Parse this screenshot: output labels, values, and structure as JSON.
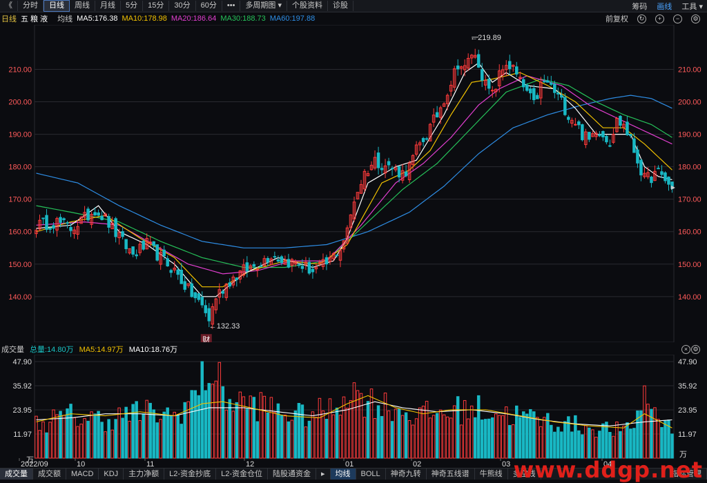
{
  "toolbar": {
    "back": "《",
    "tabs": [
      "分时",
      "日线",
      "周线",
      "月线",
      "5分",
      "15分",
      "30分",
      "60分",
      "•••",
      "多周期图 ▾",
      "个股资料",
      "诊股"
    ],
    "active": 1,
    "right": [
      "筹码",
      "画线",
      "工具 ▾"
    ]
  },
  "info": {
    "period": "日线",
    "name": "五 粮 液",
    "ma_label": "均线",
    "ma5": "MA5:176.38",
    "ma10": "MA10:178.98",
    "ma20": "MA20:186.64",
    "ma30": "MA30:188.73",
    "ma60": "MA60:197.88",
    "fq": "前复权"
  },
  "vol_info": {
    "title": "成交量",
    "total": "总量:14.80万",
    "ma5": "MA5:14.97万",
    "ma10": "MA10:18.76万"
  },
  "bottom_tabs": [
    "成交量",
    "成交额",
    "MACD",
    "KDJ",
    "主力净额",
    "L2-资金抄底",
    "L2-资金仓位",
    "陆股通资金",
    "▸",
    "均线",
    "BOLL",
    "神奇九转",
    "神奇五线谱",
    "牛熊线",
    "多空线",
    "指标管理"
  ],
  "watermark": "www.ddgp.net",
  "colors": {
    "up": "#ff3b3b",
    "down": "#19b8c4",
    "ma5": "#ffffff",
    "ma10": "#f2c200",
    "ma20": "#e23fd0",
    "ma30": "#26c25a",
    "ma60": "#2e8ee6",
    "grid": "#2a2a30",
    "axis": "#ff5a5a"
  },
  "chart_data": [
    {
      "type": "candlestick",
      "title": "五粮液 日线",
      "y_ticks": [
        140,
        150,
        160,
        170,
        180,
        190,
        200,
        210
      ],
      "ylim": [
        127,
        222
      ],
      "x_ticks": [
        "2022/09",
        "10",
        "11",
        "12",
        "01",
        "02",
        "03",
        "04"
      ],
      "annotations": [
        {
          "text": "219.89",
          "label": "high"
        },
        {
          "text": "132.33",
          "label": "low"
        },
        {
          "text": "财",
          "label": "report marker"
        }
      ],
      "ohlc_count": 150,
      "series_keypoints": {
        "close": [
          [
            0,
            162
          ],
          [
            6,
            163
          ],
          [
            10,
            161
          ],
          [
            14,
            164
          ],
          [
            17,
            167
          ],
          [
            20,
            164
          ],
          [
            24,
            158
          ],
          [
            28,
            153
          ],
          [
            32,
            156
          ],
          [
            36,
            152
          ],
          [
            40,
            148
          ],
          [
            44,
            142
          ],
          [
            48,
            137
          ],
          [
            50,
            133
          ],
          [
            52,
            140
          ],
          [
            56,
            145
          ],
          [
            60,
            148
          ],
          [
            64,
            150
          ],
          [
            68,
            153
          ],
          [
            72,
            151
          ],
          [
            76,
            150
          ],
          [
            80,
            148
          ],
          [
            84,
            150
          ],
          [
            88,
            155
          ],
          [
            90,
            160
          ],
          [
            92,
            170
          ],
          [
            95,
            178
          ],
          [
            98,
            182
          ],
          [
            102,
            180
          ],
          [
            106,
            178
          ],
          [
            108,
            180
          ],
          [
            110,
            185
          ],
          [
            113,
            190
          ],
          [
            116,
            196
          ],
          [
            118,
            201
          ],
          [
            120,
            206
          ],
          [
            122,
            212
          ],
          [
            124,
            210
          ],
          [
            126,
            215
          ],
          [
            128,
            212
          ],
          [
            130,
            205
          ],
          [
            132,
            202
          ],
          [
            134,
            208
          ],
          [
            136,
            212
          ],
          [
            138,
            210
          ],
          [
            140,
            206
          ],
          [
            142,
            203
          ],
          [
            144,
            199
          ],
          [
            146,
            205
          ],
          [
            148,
            206
          ],
          [
            150,
            203
          ],
          [
            152,
            200
          ],
          [
            154,
            196
          ],
          [
            156,
            194
          ],
          [
            158,
            190
          ],
          [
            160,
            188
          ],
          [
            162,
            192
          ],
          [
            164,
            190
          ],
          [
            166,
            188
          ],
          [
            168,
            194
          ],
          [
            170,
            193
          ],
          [
            172,
            188
          ],
          [
            174,
            182
          ],
          [
            176,
            176
          ],
          [
            178,
            177
          ],
          [
            180,
            178
          ],
          [
            182,
            176
          ],
          [
            184,
            173
          ]
        ],
        "ma5": [
          [
            0,
            161
          ],
          [
            10,
            162
          ],
          [
            18,
            168
          ],
          [
            24,
            160
          ],
          [
            32,
            156
          ],
          [
            40,
            150
          ],
          [
            48,
            140
          ],
          [
            52,
            140
          ],
          [
            60,
            147
          ],
          [
            70,
            152
          ],
          [
            80,
            149
          ],
          [
            86,
            151
          ],
          [
            90,
            158
          ],
          [
            96,
            175
          ],
          [
            104,
            180
          ],
          [
            110,
            182
          ],
          [
            118,
            196
          ],
          [
            124,
            209
          ],
          [
            128,
            212
          ],
          [
            132,
            206
          ],
          [
            136,
            209
          ],
          [
            142,
            205
          ],
          [
            150,
            204
          ],
          [
            156,
            198
          ],
          [
            162,
            190
          ],
          [
            168,
            190
          ],
          [
            172,
            190
          ],
          [
            176,
            180
          ],
          [
            180,
            177
          ],
          [
            184,
            176
          ]
        ],
        "ma10": [
          [
            0,
            160
          ],
          [
            10,
            163
          ],
          [
            20,
            165
          ],
          [
            30,
            158
          ],
          [
            40,
            152
          ],
          [
            48,
            143
          ],
          [
            54,
            143
          ],
          [
            62,
            148
          ],
          [
            72,
            151
          ],
          [
            82,
            150
          ],
          [
            90,
            156
          ],
          [
            100,
            175
          ],
          [
            108,
            179
          ],
          [
            114,
            185
          ],
          [
            120,
            196
          ],
          [
            126,
            206
          ],
          [
            132,
            207
          ],
          [
            140,
            209
          ],
          [
            148,
            205
          ],
          [
            156,
            200
          ],
          [
            164,
            192
          ],
          [
            170,
            192
          ],
          [
            176,
            187
          ],
          [
            184,
            179
          ]
        ],
        "ma20": [
          [
            0,
            162
          ],
          [
            14,
            163
          ],
          [
            24,
            162
          ],
          [
            34,
            156
          ],
          [
            44,
            150
          ],
          [
            54,
            147
          ],
          [
            64,
            148
          ],
          [
            74,
            151
          ],
          [
            84,
            151
          ],
          [
            94,
            162
          ],
          [
            104,
            175
          ],
          [
            112,
            181
          ],
          [
            120,
            189
          ],
          [
            128,
            199
          ],
          [
            134,
            204
          ],
          [
            142,
            208
          ],
          [
            152,
            205
          ],
          [
            160,
            199
          ],
          [
            168,
            195
          ],
          [
            176,
            191
          ],
          [
            184,
            187
          ]
        ],
        "ma30": [
          [
            0,
            168
          ],
          [
            10,
            166
          ],
          [
            24,
            163
          ],
          [
            36,
            157
          ],
          [
            48,
            152
          ],
          [
            60,
            149
          ],
          [
            72,
            149
          ],
          [
            84,
            151
          ],
          [
            96,
            163
          ],
          [
            106,
            173
          ],
          [
            116,
            181
          ],
          [
            126,
            192
          ],
          [
            136,
            203
          ],
          [
            146,
            207
          ],
          [
            154,
            205
          ],
          [
            162,
            200
          ],
          [
            170,
            196
          ],
          [
            178,
            193
          ],
          [
            184,
            189
          ]
        ],
        "ma60": [
          [
            0,
            178
          ],
          [
            12,
            175
          ],
          [
            24,
            168
          ],
          [
            36,
            162
          ],
          [
            48,
            157
          ],
          [
            60,
            155
          ],
          [
            72,
            155
          ],
          [
            84,
            156
          ],
          [
            96,
            160
          ],
          [
            108,
            166
          ],
          [
            118,
            174
          ],
          [
            128,
            184
          ],
          [
            138,
            192
          ],
          [
            148,
            196
          ],
          [
            158,
            199
          ],
          [
            166,
            201
          ],
          [
            172,
            202
          ],
          [
            178,
            201
          ],
          [
            184,
            198
          ]
        ]
      }
    },
    {
      "type": "bar",
      "title": "成交量",
      "unit": "万",
      "y_ticks": [
        11.97,
        23.95,
        35.92,
        47.9
      ],
      "ylim": [
        0,
        47.9
      ],
      "volume_keypoints": [
        [
          0,
          18
        ],
        [
          10,
          22
        ],
        [
          20,
          20
        ],
        [
          30,
          24
        ],
        [
          40,
          22
        ],
        [
          46,
          33
        ],
        [
          50,
          47
        ],
        [
          56,
          30
        ],
        [
          66,
          27
        ],
        [
          76,
          22
        ],
        [
          86,
          25
        ],
        [
          90,
          36
        ],
        [
          96,
          30
        ],
        [
          104,
          26
        ],
        [
          110,
          22
        ],
        [
          118,
          24
        ],
        [
          126,
          26
        ],
        [
          136,
          23
        ],
        [
          146,
          20
        ],
        [
          156,
          17
        ],
        [
          166,
          15
        ],
        [
          172,
          14
        ],
        [
          176,
          33
        ],
        [
          180,
          22
        ],
        [
          184,
          15
        ]
      ],
      "vol_ma5": [
        [
          0,
          18
        ],
        [
          10,
          22
        ],
        [
          20,
          21
        ],
        [
          30,
          23
        ],
        [
          40,
          21
        ],
        [
          48,
          27
        ],
        [
          54,
          28
        ],
        [
          62,
          25
        ],
        [
          72,
          21
        ],
        [
          82,
          20
        ],
        [
          90,
          27
        ],
        [
          96,
          31
        ],
        [
          104,
          25
        ],
        [
          112,
          22
        ],
        [
          120,
          24
        ],
        [
          130,
          24
        ],
        [
          140,
          21
        ],
        [
          150,
          18
        ],
        [
          160,
          16
        ],
        [
          170,
          15
        ],
        [
          176,
          22
        ],
        [
          184,
          15
        ]
      ],
      "vol_ma10": [
        [
          0,
          19
        ],
        [
          10,
          20
        ],
        [
          20,
          22
        ],
        [
          30,
          22
        ],
        [
          40,
          21
        ],
        [
          50,
          25
        ],
        [
          60,
          25
        ],
        [
          70,
          23
        ],
        [
          80,
          21
        ],
        [
          90,
          24
        ],
        [
          98,
          28
        ],
        [
          106,
          25
        ],
        [
          116,
          23
        ],
        [
          126,
          24
        ],
        [
          136,
          22
        ],
        [
          146,
          19
        ],
        [
          156,
          17
        ],
        [
          166,
          16
        ],
        [
          176,
          18
        ],
        [
          184,
          19
        ]
      ]
    }
  ]
}
